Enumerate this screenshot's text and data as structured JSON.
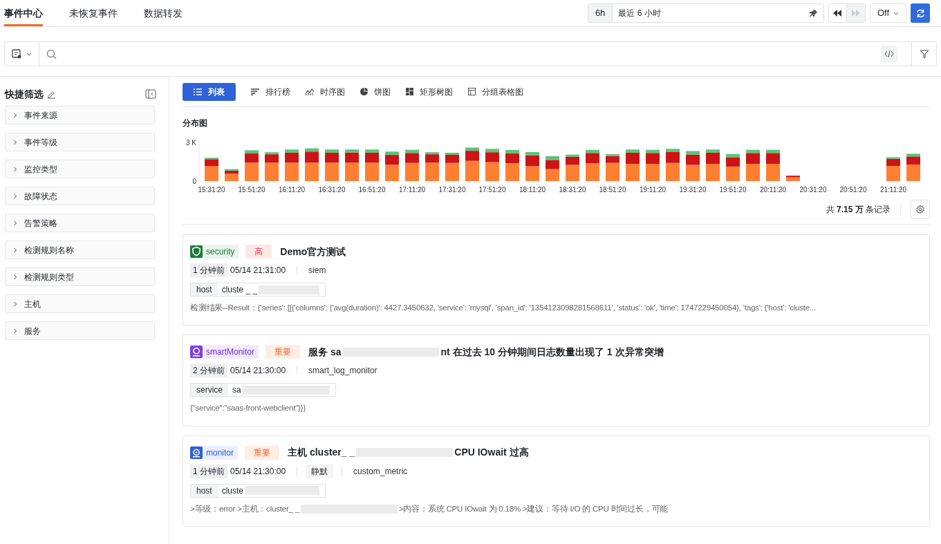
{
  "nav_tabs": [
    {
      "label": "事件中心",
      "selected": true
    },
    {
      "label": "未恢复事件",
      "selected": false
    },
    {
      "label": "数据转发",
      "selected": false
    }
  ],
  "time_controls": {
    "range_short": "6h",
    "range_label": "最近 6 小时",
    "refresh_mode": "Off",
    "forward_disabled": true
  },
  "sidebar": {
    "title": "快捷筛选",
    "filters": [
      {
        "label": "事件来源",
        "expanded": false
      },
      {
        "label": "事件等级",
        "expanded": false
      },
      {
        "label": "监控类型",
        "expanded": false
      },
      {
        "label": "故障状态",
        "expanded": false
      },
      {
        "label": "告警策略",
        "expanded": false
      },
      {
        "label": "检测规则名称",
        "expanded": false
      },
      {
        "label": "检测规则类型",
        "expanded": false
      },
      {
        "label": "主机",
        "expanded": false
      },
      {
        "label": "服务",
        "expanded": false
      }
    ]
  },
  "view_tabs": [
    {
      "label": "列表",
      "kind": "list",
      "selected": true
    },
    {
      "label": "排行榜",
      "kind": "rank",
      "selected": false
    },
    {
      "label": "时序图",
      "kind": "timeseries",
      "selected": false
    },
    {
      "label": "饼图",
      "kind": "pie",
      "selected": false
    },
    {
      "label": "矩形树图",
      "kind": "treemap",
      "selected": false
    },
    {
      "label": "分组表格图",
      "kind": "table",
      "selected": false
    }
  ],
  "distribution": {
    "title": "分布图",
    "chart_data": {
      "type": "bar",
      "stacked": true,
      "ylim": [
        0,
        3000
      ],
      "yticks": [
        {
          "value": 0,
          "label": "0"
        },
        {
          "value": 3000,
          "label": "3 K"
        }
      ],
      "categories": [
        "15:31:20",
        null,
        "15:51:20",
        null,
        "16:11:20",
        null,
        "16:31:20",
        null,
        "16:51:20",
        null,
        "17:11:20",
        null,
        "17:31:20",
        null,
        "17:51:20",
        null,
        "18:11:20",
        null,
        "18:31:20",
        null,
        "18:51:20",
        null,
        "19:11:20",
        null,
        "19:31:20",
        null,
        "19:51:20",
        null,
        "20:11:20",
        null,
        "20:31:20",
        null,
        "20:51:20",
        null,
        "21:11:20",
        null
      ],
      "series": [
        {
          "color": "#ff7f32",
          "values": [
            1150,
            570,
            1430,
            1430,
            1430,
            1430,
            1430,
            1430,
            1430,
            1280,
            1410,
            1430,
            1410,
            1570,
            1470,
            1390,
            1150,
            930,
            1260,
            1390,
            1410,
            1340,
            1340,
            1410,
            1260,
            1320,
            1130,
            1340,
            1340,
            290,
            0,
            0,
            0,
            0,
            1170,
            1280
          ]
        },
        {
          "color": "#cc1417",
          "values": [
            550,
            230,
            710,
            650,
            770,
            860,
            770,
            790,
            770,
            750,
            770,
            650,
            630,
            780,
            770,
            750,
            840,
            710,
            620,
            790,
            530,
            860,
            840,
            870,
            800,
            880,
            720,
            840,
            840,
            130,
            0,
            0,
            0,
            0,
            550,
            630
          ]
        },
        {
          "color": "#5cc47a",
          "values": [
            110,
            120,
            250,
            160,
            250,
            250,
            250,
            230,
            250,
            260,
            250,
            160,
            160,
            250,
            260,
            270,
            260,
            290,
            170,
            240,
            150,
            250,
            250,
            220,
            270,
            250,
            250,
            250,
            250,
            0,
            0,
            0,
            0,
            0,
            130,
            210
          ]
        }
      ]
    }
  },
  "summary": "共 **7.15 万** 条记录",
  "events": [
    {
      "source": {
        "kind": "security",
        "label": "security"
      },
      "level": {
        "kind": "high",
        "label": "高"
      },
      "title": [
        {
          "kind": "text",
          "text": "Demo官方测试"
        }
      ],
      "meta": [
        {
          "kind": "age",
          "text": "1 分钟前"
        },
        {
          "kind": "time",
          "text": "05/14 21:31:00"
        },
        {
          "kind": "origin",
          "text": "siem"
        }
      ],
      "tag": {
        "key": "host",
        "value": [
          {
            "kind": "text",
            "text": "cluste _ _"
          },
          {
            "kind": "redacted"
          }
        ]
      },
      "detail": [
        {
          "kind": "text",
          "text": "检测结果--Result：{'series': [[{'columns': {'avg(duration)': 4427.3450632, 'service': 'mysql', 'span_id': '1354123098281568611', 'status': 'ok', 'time': 1747229450054}, 'tags': {'host': 'cluste..."
        }
      ]
    },
    {
      "source": {
        "kind": "smart",
        "label": "smartMonitor"
      },
      "level": {
        "kind": "important",
        "label": "重要"
      },
      "title": [
        {
          "kind": "text",
          "text": "服务 sa"
        },
        {
          "kind": "redacted"
        },
        {
          "kind": "text",
          "text": "nt 在过去 10 分钟期间日志数量出现了 1 次异常突增"
        }
      ],
      "meta": [
        {
          "kind": "age",
          "text": "2 分钟前"
        },
        {
          "kind": "time",
          "text": "05/14 21:30:00"
        },
        {
          "kind": "origin",
          "text": "smart_log_monitor"
        }
      ],
      "tag": {
        "key": "service",
        "value": [
          {
            "kind": "text",
            "text": "sa"
          },
          {
            "kind": "redacted"
          }
        ]
      },
      "detail": [
        {
          "kind": "text",
          "text": "{\"service\":\"saas-front-webclient\"}}}"
        }
      ]
    },
    {
      "source": {
        "kind": "monitor",
        "label": "monitor"
      },
      "level": {
        "kind": "important",
        "label": "重要"
      },
      "title": [
        {
          "kind": "text",
          "text": "主机 cluster_ _"
        },
        {
          "kind": "redacted"
        },
        {
          "kind": "text",
          "text": "CPU IOwait 过高"
        }
      ],
      "meta": [
        {
          "kind": "age",
          "text": "1 分钟前"
        },
        {
          "kind": "time",
          "text": "05/14 21:30:00"
        },
        {
          "kind": "status",
          "text": "静默"
        },
        {
          "kind": "origin",
          "text": "custom_metric"
        }
      ],
      "tag": {
        "key": "host",
        "value": [
          {
            "kind": "text",
            "text": "cluste"
          },
          {
            "kind": "redacted"
          }
        ]
      },
      "detail": [
        {
          "kind": "text",
          "text": ">等级：error >主机：cluster_ _"
        },
        {
          "kind": "redacted"
        },
        {
          "kind": "text",
          "text": ">内容：系统 CPU IOwait 为 0.18% >建议：等待 I/O 的 CPU 时间过长，可能"
        }
      ]
    }
  ]
}
